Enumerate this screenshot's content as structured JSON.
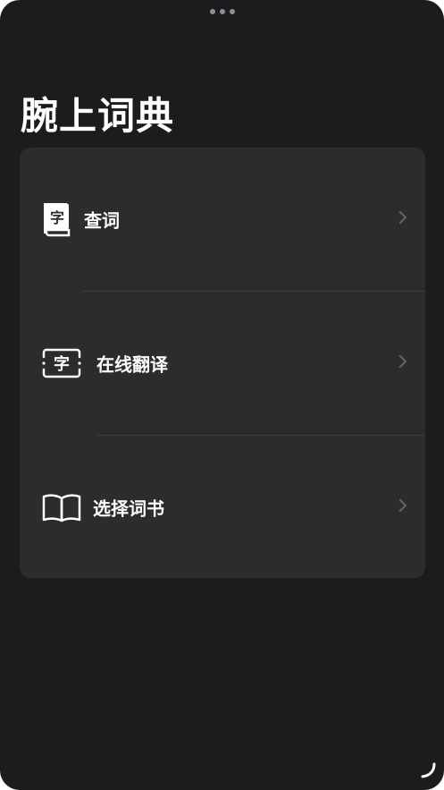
{
  "app": {
    "title": "腕上词典"
  },
  "menu": {
    "items": [
      {
        "label": "查词",
        "icon": "dictionary-book-icon"
      },
      {
        "label": "在线翻译",
        "icon": "text-frame-translate-icon"
      },
      {
        "label": "选择词书",
        "icon": "open-book-icon"
      }
    ]
  },
  "icon_glyph": "字",
  "colors": {
    "background": "#1c1c1e",
    "card": "#2c2c2e",
    "separator": "#3d3d40",
    "text": "#ffffff",
    "chevron": "#636366"
  }
}
